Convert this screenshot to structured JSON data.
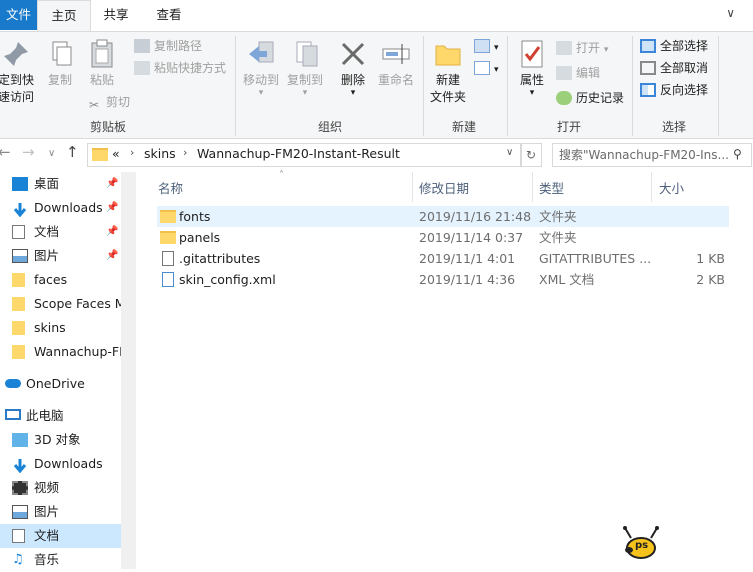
{
  "ribbon_tabs": {
    "file": "文件",
    "home": "主页",
    "share": "共享",
    "view": "查看"
  },
  "clipboard": {
    "pin": "固定到快\n速访问",
    "pin_l1": "定到快",
    "pin_l2": "速访问",
    "copy": "复制",
    "paste": "粘贴",
    "copy_path": "复制路径",
    "paste_shortcut": "粘贴快捷方式",
    "cut": "剪切",
    "label": "剪贴板"
  },
  "organize": {
    "move_to": "移动到",
    "copy_to": "复制到",
    "delete": "删除",
    "rename": "重命名",
    "label": "组织"
  },
  "new": {
    "new_folder_l1": "新建",
    "new_folder_l2": "文件夹",
    "label": "新建"
  },
  "open": {
    "properties": "属性",
    "open": "打开",
    "edit": "编辑",
    "history": "历史记录",
    "label": "打开"
  },
  "select": {
    "select_all": "全部选择",
    "select_none": "全部取消",
    "invert": "反向选择",
    "label": "选择"
  },
  "address": {
    "overflow": "«",
    "crumbs": [
      "skins",
      "Wannachup-FM20-Instant-Result"
    ]
  },
  "search": {
    "placeholder": "搜索\"Wannachup-FM20-Ins..."
  },
  "nav": {
    "quick": [
      {
        "label": "桌面",
        "icon": "desktop-icon",
        "pinned": true
      },
      {
        "label": "Downloads",
        "icon": "download-icon",
        "pinned": true
      },
      {
        "label": "文档",
        "icon": "document-icon",
        "pinned": true
      },
      {
        "label": "图片",
        "icon": "picture-icon",
        "pinned": true
      },
      {
        "label": "faces",
        "icon": "folder-icon",
        "pinned": false
      },
      {
        "label": "Scope Faces M",
        "icon": "folder-icon",
        "pinned": false
      },
      {
        "label": "skins",
        "icon": "folder-icon",
        "pinned": false
      },
      {
        "label": "Wannachup-FM",
        "icon": "folder-icon",
        "pinned": false
      }
    ],
    "onedrive": "OneDrive",
    "pc": "此电脑",
    "pc_items": [
      {
        "label": "3D 对象",
        "icon": "3d-objects-icon"
      },
      {
        "label": "Downloads",
        "icon": "download-icon"
      },
      {
        "label": "视频",
        "icon": "video-icon"
      },
      {
        "label": "图片",
        "icon": "picture-icon"
      },
      {
        "label": "文档",
        "icon": "document-icon"
      },
      {
        "label": "音乐",
        "icon": "music-icon"
      }
    ]
  },
  "columns": {
    "name": "名称",
    "date": "修改日期",
    "type": "类型",
    "size": "大小"
  },
  "files": [
    {
      "name": "fonts",
      "date": "2019/11/16 21:48",
      "type": "文件夹",
      "size": "",
      "kind": "folder"
    },
    {
      "name": "panels",
      "date": "2019/11/14 0:37",
      "type": "文件夹",
      "size": "",
      "kind": "folder"
    },
    {
      "name": ".gitattributes",
      "date": "2019/11/1 4:01",
      "type": "GITATTRIBUTES ...",
      "size": "1 KB",
      "kind": "file"
    },
    {
      "name": "skin_config.xml",
      "date": "2019/11/1 4:36",
      "type": "XML 文档",
      "size": "2 KB",
      "kind": "xml"
    }
  ],
  "watermark": "ps"
}
